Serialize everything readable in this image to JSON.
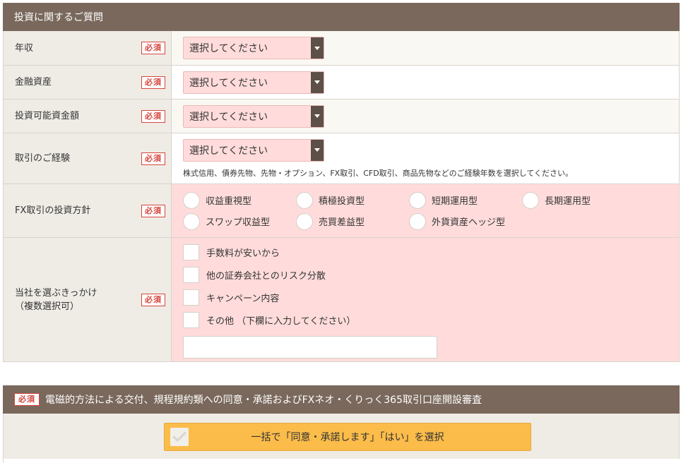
{
  "section1": {
    "title": "投資に関するご質問"
  },
  "required_label": "必須",
  "select_placeholder": "選択してください",
  "rows": {
    "income": {
      "label": "年収"
    },
    "assets": {
      "label": "金融資産"
    },
    "investable": {
      "label": "投資可能資金額"
    },
    "experience": {
      "label": "取引のご経験",
      "note": "株式信用、債券先物、先物・オプション、FX取引、CFD取引、商品先物などのご経験年数を選択してください。"
    },
    "policy": {
      "label": "FX取引の投資方針",
      "options": [
        "収益重視型",
        "積極投資型",
        "短期運用型",
        "長期運用型",
        "スワップ収益型",
        "売買差益型",
        "外貨資産ヘッジ型"
      ]
    },
    "reason": {
      "label_line1": "当社を選ぶきっかけ",
      "label_line2": "（複数選択可）",
      "options": [
        "手数料が安いから",
        "他の証券会社とのリスク分散",
        "キャンペーン内容",
        "その他 （下欄に入力してください）"
      ],
      "other_value": ""
    }
  },
  "section2": {
    "title": "電磁的方法による交付、規程規約類への同意・承諾およびFXネオ・くりっく365取引口座開設審査",
    "consent_button": "一括で「同意・承諾します」「はい」を選択"
  },
  "colors": {
    "header_bg": "#7a685c",
    "required_red": "#d6453d",
    "pink_bg": "#ffdcdb",
    "consent_orange": "#fbbc4a"
  }
}
